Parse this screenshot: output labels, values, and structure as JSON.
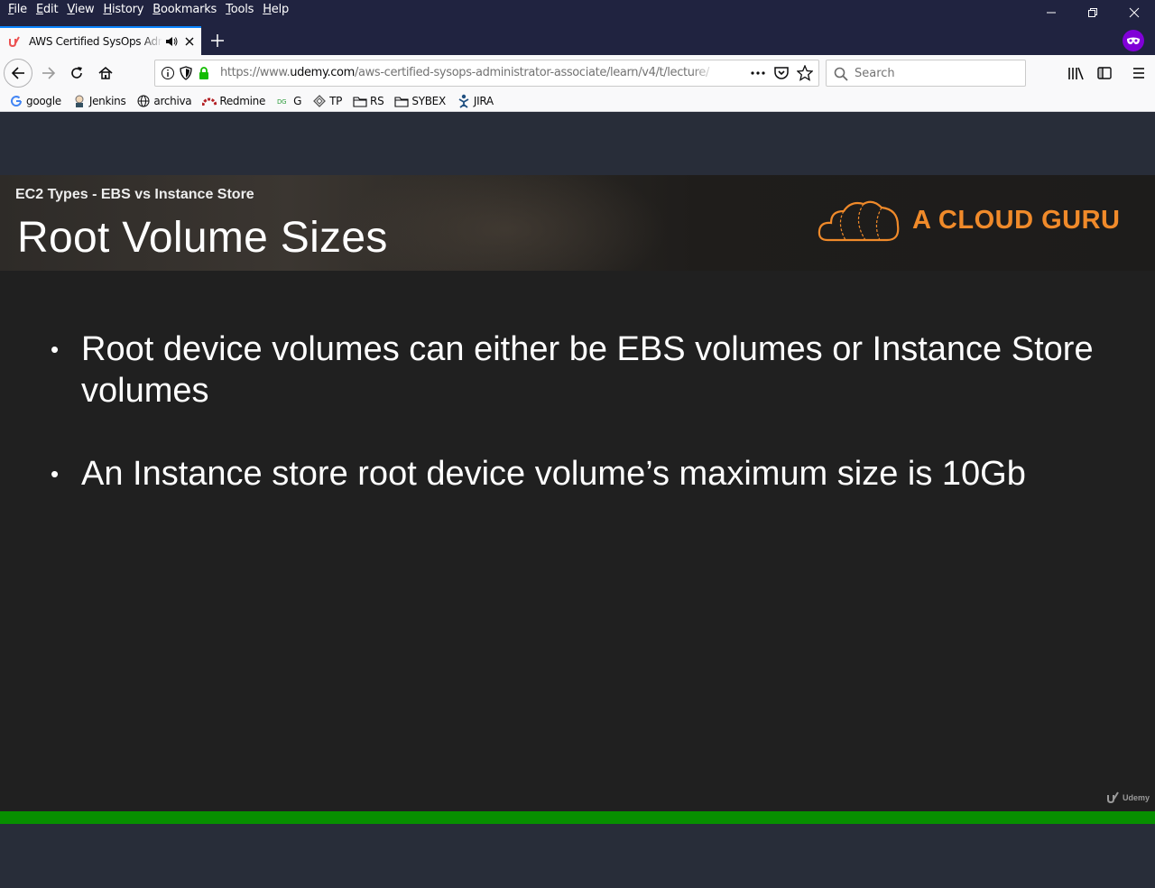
{
  "menu": [
    "File",
    "Edit",
    "View",
    "History",
    "Bookmarks",
    "Tools",
    "Help"
  ],
  "tab": {
    "title": "AWS Certified SysOps Administrator - Associate"
  },
  "nav": {
    "url_prefix": "https://www.",
    "url_domain": "udemy.com",
    "url_path": "/aws-certified-sysops-administrator-associate/learn/v4/t/lecture/",
    "search_placeholder": "Search"
  },
  "bookmarks": [
    "google",
    "Jenkins",
    "archiva",
    "Redmine",
    "G",
    "TP",
    "RS",
    "SYBEX",
    "JIRA"
  ],
  "slide": {
    "subtitle": "EC2 Types - EBS vs Instance Store",
    "title": "Root Volume Sizes",
    "logo_text": "A CLOUD GURU",
    "bullets": [
      "Root device volumes can either be EBS volumes or Instance Store volumes",
      "An Instance store root device volume’s maximum size is 10Gb"
    ],
    "watermark": "Udemy"
  },
  "player": {
    "progress_fraction": 1.0
  },
  "colors": {
    "accent_orange": "#f08a2a",
    "progress_green": "#078f00",
    "private_purple": "#8000d7"
  }
}
